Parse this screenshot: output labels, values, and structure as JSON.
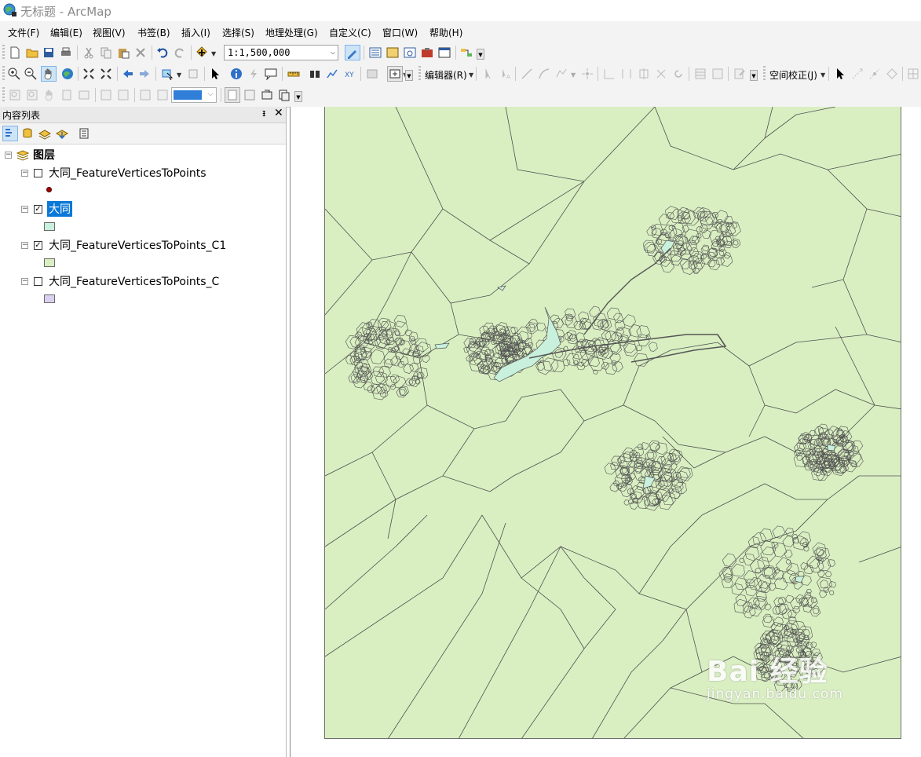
{
  "window": {
    "title": "无标题 - ArcMap",
    "icon": "arcmap-globe-icon"
  },
  "menu": [
    {
      "label": "文件(F)"
    },
    {
      "label": "编辑(E)"
    },
    {
      "label": "视图(V)"
    },
    {
      "label": "书签(B)"
    },
    {
      "label": "插入(I)"
    },
    {
      "label": "选择(S)"
    },
    {
      "label": "地理处理(G)"
    },
    {
      "label": "自定义(C)"
    },
    {
      "label": "窗口(W)"
    },
    {
      "label": "帮助(H)"
    }
  ],
  "toolbar": {
    "scale": "1:1,500,000",
    "editor_label": "编辑器(R)",
    "spatial_adjust_label": "空间校正(J)"
  },
  "toc": {
    "title": "内容列表",
    "root": "图层",
    "layers": [
      {
        "name": "大同_FeatureVerticesToPoints",
        "checked": false,
        "symbol": "point",
        "symbol_color": "#b00000"
      },
      {
        "name": "大同",
        "checked": true,
        "selected": true,
        "symbol": "polygon",
        "symbol_color": "#c8f0dc"
      },
      {
        "name": "大同_FeatureVerticesToPoints_C1",
        "checked": true,
        "symbol": "polygon",
        "symbol_color": "#d9efc2"
      },
      {
        "name": "大同_FeatureVerticesToPoints_C",
        "checked": false,
        "symbol": "polygon",
        "symbol_color": "#dcd0f0"
      }
    ]
  },
  "map": {
    "background": "#d9efc2",
    "water_color": "#c8f0dc",
    "watermark": {
      "main": "Bai 经验",
      "sub": "jingyan.baidu.com"
    }
  },
  "colors": {
    "selection": "#0a78d7",
    "frame_border": "#6d6d6d"
  }
}
